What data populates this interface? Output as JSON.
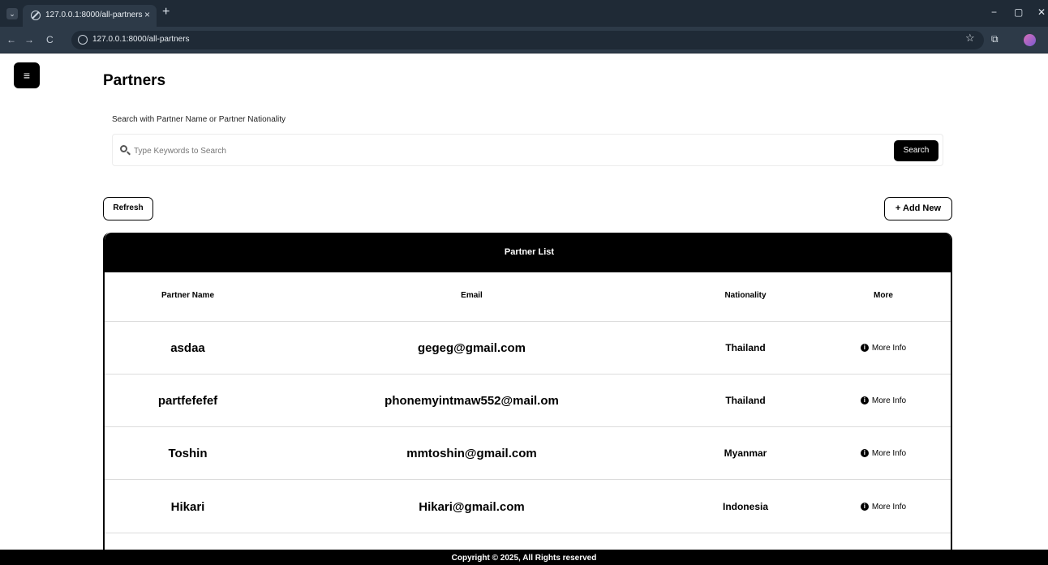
{
  "browser": {
    "tab_title": "127.0.0.1:8000/all-partners",
    "tab_close": "×",
    "new_tab": "+",
    "url": "127.0.0.1:8000/all-partners",
    "back": "←",
    "forward": "→",
    "reload": "C",
    "star": "☆",
    "minimize": "−",
    "restore": "▢",
    "close": "✕"
  },
  "page": {
    "menu_icon": "≡",
    "title": "Partners",
    "search_label": "Search with Partner Name or Partner Nationality",
    "search_placeholder": "Type Keywords to Search",
    "search_button": "Search",
    "refresh_button": "Refresh",
    "add_new_button": "+ Add New"
  },
  "table": {
    "title": "Partner List",
    "headers": {
      "name": "Partner Name",
      "email": "Email",
      "nationality": "Nationality",
      "more": "More"
    },
    "rows": [
      {
        "name": "asdaa",
        "email": "gegeg@gmail.com",
        "nationality": "Thailand",
        "more": "More Info"
      },
      {
        "name": "partfefefef",
        "email": "phonemyintmaw552@mail.om",
        "nationality": "Thailand",
        "more": "More Info"
      },
      {
        "name": "Toshin",
        "email": "mmtoshin@gmail.com",
        "nationality": "Myanmar",
        "more": "More Info"
      },
      {
        "name": "Hikari",
        "email": "Hikari@gmail.com",
        "nationality": "Indonesia",
        "more": "More Info"
      }
    ]
  },
  "footer": {
    "text": "Copyright © 2025, All Rights reserved"
  }
}
